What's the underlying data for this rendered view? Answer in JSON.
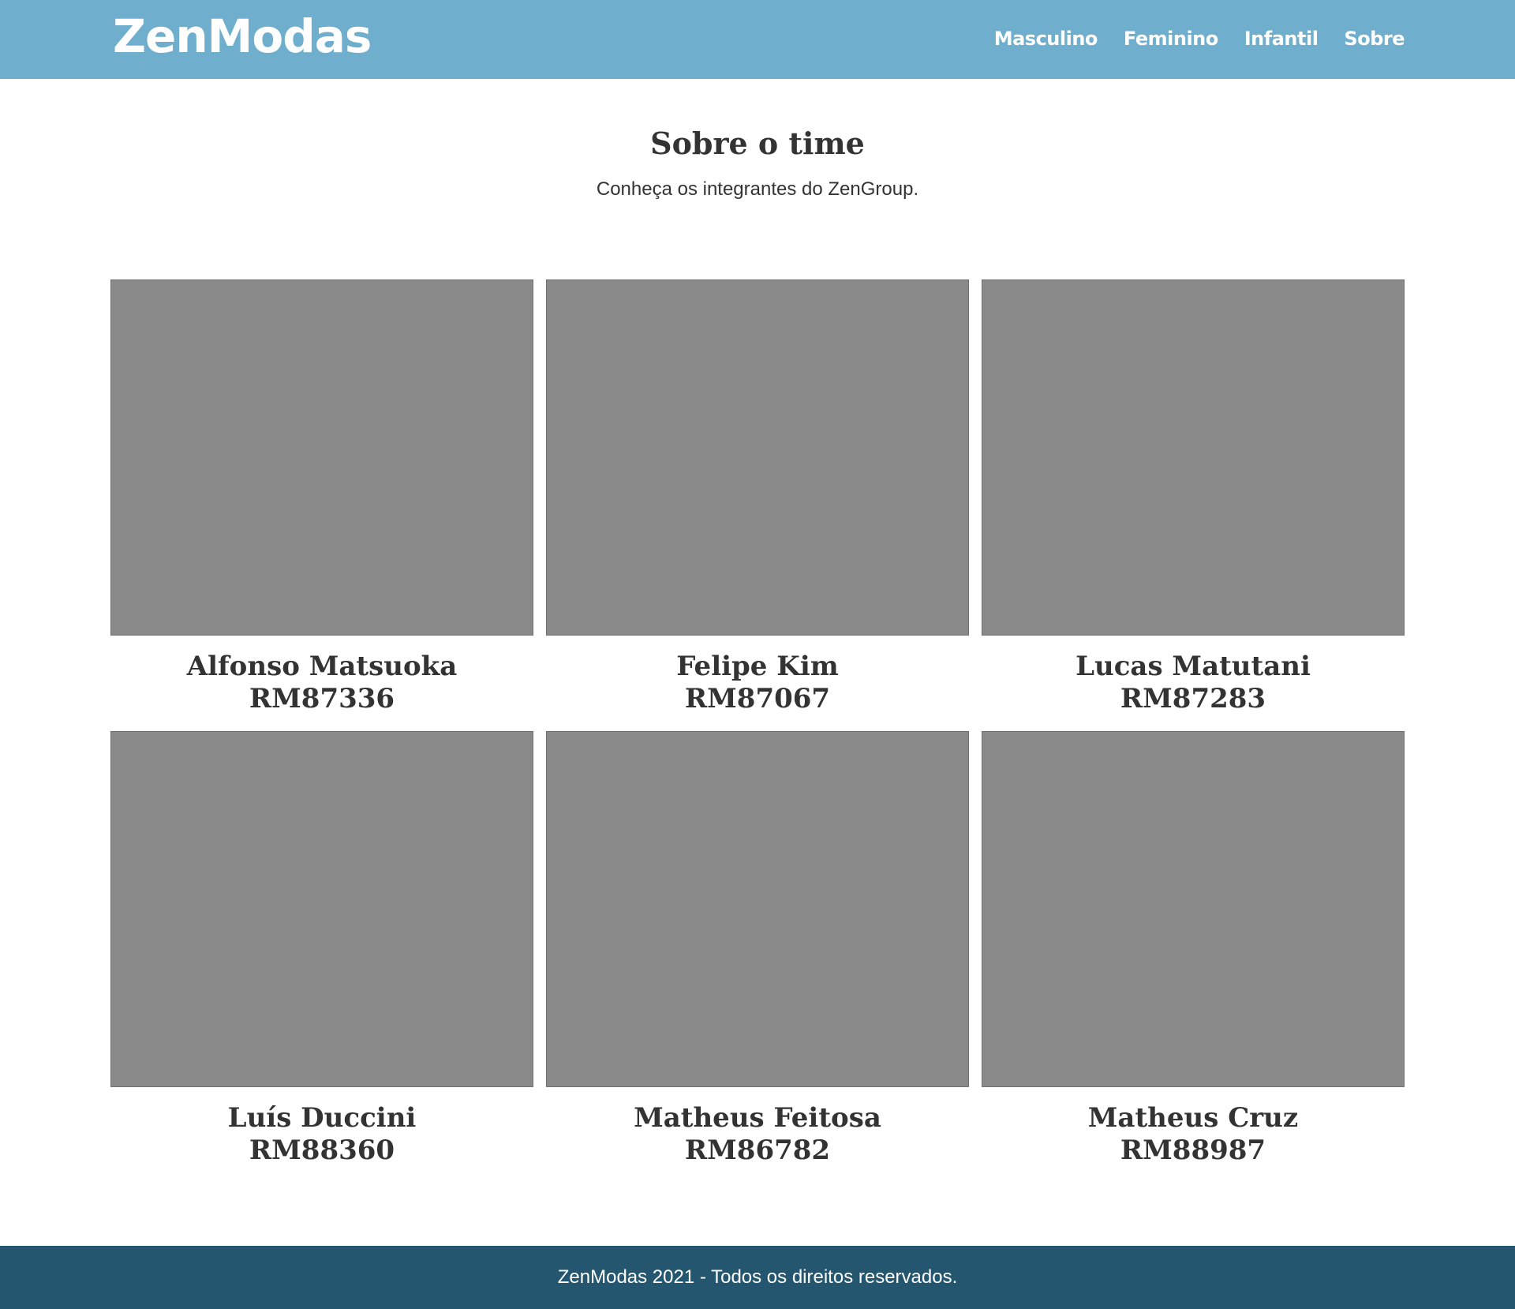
{
  "header": {
    "logo": "ZenModas",
    "nav": [
      "Masculino",
      "Feminino",
      "Infantil",
      "Sobre"
    ]
  },
  "main": {
    "title": "Sobre o time",
    "subtitle": "Conheça os integrantes do ZenGroup.",
    "members": [
      {
        "name": "Alfonso Matsuoka",
        "rm": "RM87336"
      },
      {
        "name": "Felipe Kim",
        "rm": "RM87067"
      },
      {
        "name": "Lucas Matutani",
        "rm": "RM87283"
      },
      {
        "name": "Luís Duccini",
        "rm": "RM88360"
      },
      {
        "name": "Matheus Feitosa",
        "rm": "RM86782"
      },
      {
        "name": "Matheus Cruz",
        "rm": "RM88987"
      }
    ]
  },
  "footer": {
    "text": "ZenModas 2021 - Todos os direitos reservados."
  },
  "colors": {
    "header_bg": "#6fafcd",
    "footer_bg": "#24576f",
    "photo_placeholder": "#898989",
    "text": "#333333"
  }
}
